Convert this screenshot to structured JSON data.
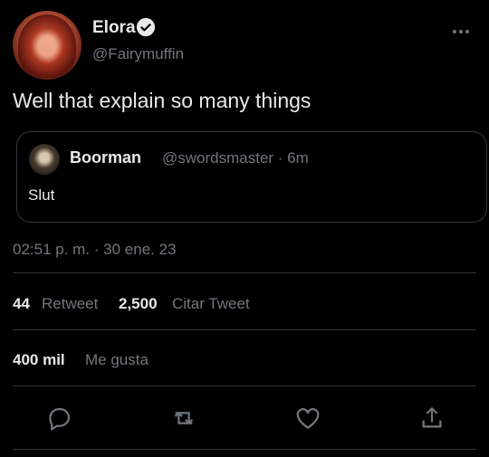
{
  "author": {
    "name": "Elora",
    "handle": "@Fairymuffin"
  },
  "tweet": {
    "text": "Well that explain so many things"
  },
  "quoted_tweet": {
    "name": "Boorman",
    "handle_time": "@swordsmaster · 6m",
    "text": "Slut"
  },
  "timestamp": "02:51 p. m. · 30 ene. 23",
  "stats": {
    "retweets_count": "44",
    "retweets_label": "Retweet",
    "quotes_count": "2,500",
    "quotes_label": "Citar Tweet",
    "likes_count": "400 mil",
    "likes_label": "Me gusta"
  },
  "icons": {
    "verified": "verified-badge-icon",
    "more": "more-horizontal-icon",
    "reply": "reply-icon",
    "retweet": "retweet-icon",
    "like": "heart-icon",
    "share": "share-icon"
  },
  "colors": {
    "background": "#000000",
    "text_primary": "#e7e9ea",
    "text_secondary": "#71767b",
    "accent": "#1d9bf0",
    "divider": "#2f3336"
  }
}
